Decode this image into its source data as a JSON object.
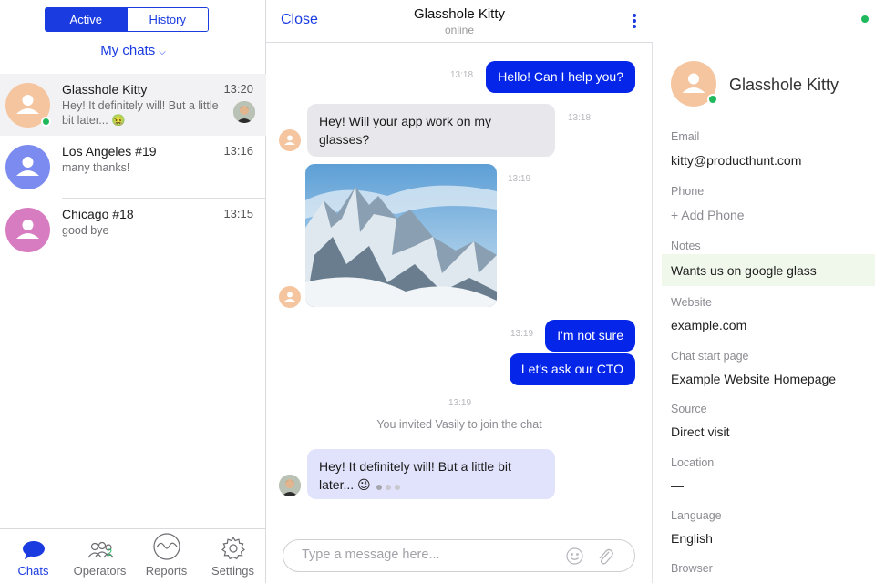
{
  "sidebar": {
    "segment": {
      "active_label": "Active",
      "history_label": "History"
    },
    "filter_label": "My chats",
    "chats": [
      {
        "name": "Glasshole Kitty",
        "time": "13:20",
        "preview": "Hey! It definitely will! But a little bit later... 🤢",
        "avatar_color": "#f4c59f",
        "online": true
      },
      {
        "name": "Los Angeles #19",
        "time": "13:16",
        "preview": "many thanks!",
        "avatar_color": "#7c8bf0",
        "online": false
      },
      {
        "name": "Chicago #18",
        "time": "13:15",
        "preview": "good bye",
        "avatar_color": "#d77cc0",
        "online": false
      }
    ],
    "tabs": [
      {
        "label": "Chats",
        "icon": "chat-bubble-icon"
      },
      {
        "label": "Operators",
        "icon": "operators-icon",
        "count": "2"
      },
      {
        "label": "Reports",
        "icon": "reports-icon"
      },
      {
        "label": "Settings",
        "icon": "gear-icon"
      }
    ]
  },
  "conversation": {
    "close_label": "Close",
    "title": "Glasshole Kitty",
    "status": "online",
    "messages": [
      {
        "direction": "out",
        "time": "13:18",
        "text": "Hello! Can I help you?"
      },
      {
        "direction": "in",
        "time": "13:18",
        "text": "Hey! Will your app work on my glasses?"
      },
      {
        "direction": "in",
        "time": "13:19",
        "type": "image",
        "image": "mountain-photo"
      },
      {
        "direction": "out",
        "time": "13:19",
        "text": "I'm not sure"
      },
      {
        "direction": "out",
        "text": "Let's ask our CTO"
      },
      {
        "direction": "system",
        "time": "13:19",
        "text": "You invited Vasily to join the chat"
      },
      {
        "direction": "in",
        "text": "Hey! It definitely will! But a little bit later... 😉",
        "typing": true
      }
    ],
    "composer_placeholder": "Type a message here..."
  },
  "profile": {
    "name": "Glasshole Kitty",
    "fields": [
      {
        "label": "Email",
        "value": "kitty@producthunt.com"
      },
      {
        "label": "Phone",
        "value": "+ Add Phone"
      },
      {
        "label": "Notes",
        "value": "Wants us on google glass"
      },
      {
        "label": "Website",
        "value": "example.com"
      },
      {
        "label": "Chat start page",
        "value": "Example Website Homepage"
      },
      {
        "label": "Source",
        "value": "Direct visit"
      },
      {
        "label": "Location",
        "value": "—"
      },
      {
        "label": "Language",
        "value": "English"
      },
      {
        "label": "Browser",
        "value": ""
      }
    ]
  },
  "colors": {
    "accent": "#1a3be0",
    "online": "#1fb85c",
    "outgoing_bubble": "#0526e8"
  }
}
